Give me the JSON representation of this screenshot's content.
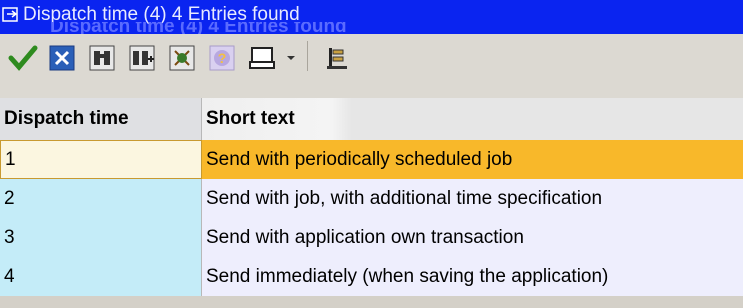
{
  "window": {
    "title": "Dispatch time (4)    4 Entries found",
    "ghost_title": "Dispatch time (4)    4 Entries found"
  },
  "toolbar": {
    "buttons": [
      {
        "name": "confirm-button",
        "icon": "checkmark-icon"
      },
      {
        "name": "cancel-button",
        "icon": "cancel-icon"
      },
      {
        "name": "find-button",
        "icon": "binoculars-icon"
      },
      {
        "name": "find-next-button",
        "icon": "binoculars-plus-icon"
      },
      {
        "name": "restrict-button",
        "icon": "filter-icon"
      },
      {
        "name": "help-button",
        "icon": "help-icon"
      },
      {
        "name": "print-button",
        "icon": "printer-icon"
      },
      {
        "name": "print-dropdown",
        "icon": "chevron-down-icon"
      },
      {
        "name": "settings-button",
        "icon": "settings-icon"
      }
    ]
  },
  "colors": {
    "title_bg": "#0a24f0",
    "selected_row": "#f8b82a",
    "key_cell": "#c4ecf8",
    "text_cell": "#eeeefd"
  },
  "table": {
    "headers": [
      "Dispatch time",
      "Short text"
    ],
    "rows": [
      {
        "key": "1",
        "text": "Send with periodically scheduled job",
        "selected": true
      },
      {
        "key": "2",
        "text": "Send with job, with additional time specification",
        "selected": false
      },
      {
        "key": "3",
        "text": "Send with application own transaction",
        "selected": false
      },
      {
        "key": "4",
        "text": "Send immediately (when saving the application)",
        "selected": false
      }
    ]
  }
}
